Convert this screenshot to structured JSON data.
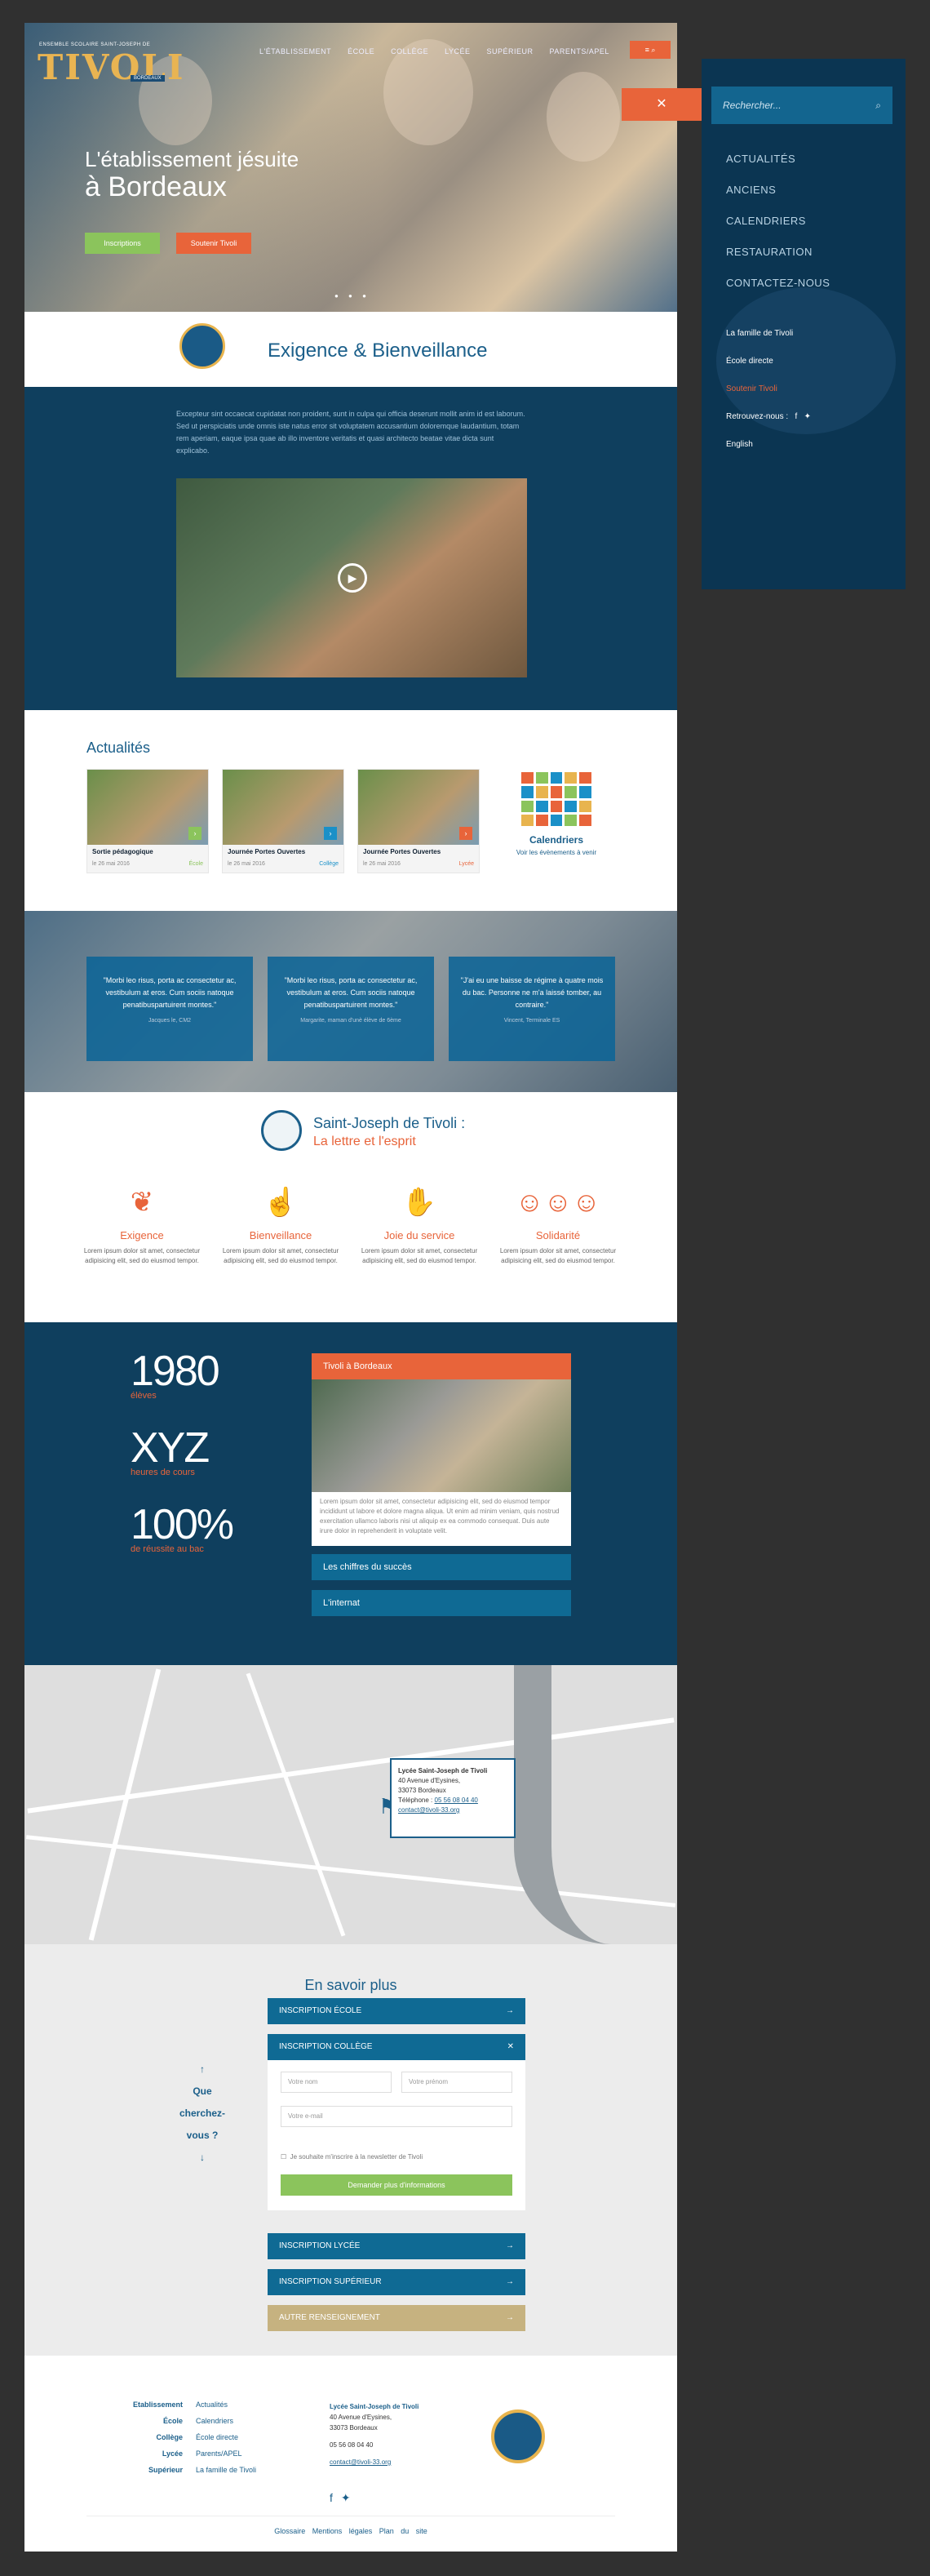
{
  "header": {
    "logo_small": "ENSEMBLE SCOLAIRE SAINT-JOSEPH DE",
    "logo": "TIVOLI",
    "logo_sub": "BORDEAUX",
    "nav": [
      "L'ÉTABLISSEMENT",
      "ÉCOLE",
      "COLLÈGE",
      "LYCÉE",
      "SUPÉRIEUR",
      "PARENTS/APEL"
    ],
    "menu_btn": "≡  ⌕"
  },
  "hero": {
    "title_line1": "L'établissement jésuite",
    "title_line2": "à Bordeaux",
    "btn_primary": "Inscriptions",
    "btn_secondary": "Soutenir Tivoli",
    "dots": "● ● ●"
  },
  "intro": {
    "heading": "Exigence & Bienveillance",
    "text": "Excepteur sint occaecat cupidatat non proident, sunt in culpa qui officia deserunt mollit anim id est laborum. Sed ut perspiciatis unde omnis iste natus error sit voluptatem accusantium doloremque laudantium, totam rem aperiam, eaque ipsa quae ab illo inventore veritatis et quasi architecto beatae vitae dicta sunt explicabo."
  },
  "news": {
    "heading": "Actualités",
    "cards": [
      {
        "title": "Sortie pédagogique",
        "date": "le 26 mai 2016",
        "cat": "École",
        "color": "#8bc45c"
      },
      {
        "title": "Journée Portes Ouvertes",
        "date": "le 26 mai 2016",
        "cat": "Collège",
        "color": "#1a90c8"
      },
      {
        "title": "Journée Portes Ouvertes",
        "date": "le 26 mai 2016",
        "cat": "Lycée",
        "color": "#e8643a"
      }
    ],
    "cal_title": "Calendriers",
    "cal_sub": "Voir les évènements à venir"
  },
  "quotes": [
    {
      "text": "\"Morbi leo risus, porta ac consectetur ac, vestibulum at eros. Cum sociis natoque penatibuspartuirent montes.\"",
      "author": "Jacques le, CM2"
    },
    {
      "text": "\"Morbi leo risus, porta ac consectetur ac, vestibulum at eros. Cum sociis natoque penatibuspartuirent montes.\"",
      "author": "Margarite, maman d'unè élève de 6ème"
    },
    {
      "text": "\"J'ai eu une baisse de régime à quatre mois du bac. Personne ne m'a laissé tomber, au contraire.\"",
      "author": "Vincent, Terminale ES"
    }
  ],
  "values": {
    "title1": "Saint-Joseph de Tivoli :",
    "title2": "La lettre et l'esprit",
    "items": [
      {
        "name": "Exigence",
        "icon": "laurel-icon",
        "text": "Lorem ipsum dolor sit amet, consectetur adipisicing elit, sed do eiusmod tempor."
      },
      {
        "name": "Bienveillance",
        "icon": "hands-icon",
        "text": "Lorem ipsum dolor sit amet, consectetur adipisicing elit, sed do eiusmod tempor."
      },
      {
        "name": "Joie du service",
        "icon": "handshake-icon",
        "text": "Lorem ipsum dolor sit amet, consectetur adipisicing elit, sed do eiusmod tempor."
      },
      {
        "name": "Solidarité",
        "icon": "people-icon",
        "text": "Lorem ipsum dolor sit amet, consectetur adipisicing elit, sed do eiusmod tempor."
      }
    ]
  },
  "stats": {
    "items": [
      {
        "value": "1980",
        "label": "élèves"
      },
      {
        "value": "XYZ",
        "label": "heures de cours"
      },
      {
        "value": "100%",
        "label": "de réussite au bac"
      }
    ],
    "acc1": "Tivoli à Bordeaux",
    "acc_text": "Lorem ipsum dolor sit amet, consectetur adipisicing elit, sed do eiusmod tempor incididunt ut labore et dolore magna aliqua. Ut enim ad minim veniam, quis nostrud exercitation ullamco laboris nisi ut aliquip ex ea commodo consequat. Duis aute irure dolor in reprehenderit in voluptate velit.",
    "acc2": "Les chiffres du succès",
    "acc3": "L'internat"
  },
  "map": {
    "name": "Lycée Saint-Joseph de Tivoli",
    "addr1": "40 Avenue d'Eysines,",
    "addr2": "33073 Bordeaux",
    "phone_label": "Téléphone :",
    "phone": "05 56 08 04 40",
    "email": "contact@tivoli-33.org"
  },
  "more": {
    "heading": "En savoir plus",
    "side": [
      "↑",
      "Que",
      "cherchez-",
      "vous ?",
      "↓"
    ],
    "ac1": "INSCRIPTION ÉCOLE",
    "ac2": "INSCRIPTION COLLÈGE",
    "ph_name": "Votre nom",
    "ph_first": "Votre prénom",
    "ph_email": "Votre e-mail",
    "checkbox": "Je souhaite m'inscrire à la newsletter de Tivoli",
    "submit": "Demander plus d'informations",
    "ac3": "INSCRIPTION LYCÉE",
    "ac4": "INSCRIPTION SUPÉRIEUR",
    "ac5": "AUTRE RENSEIGNEMENT",
    "arrow": "→",
    "close": "✕"
  },
  "footer": {
    "left": [
      "Etablissement",
      "École",
      "Collège",
      "Lycée",
      "Supérieur"
    ],
    "right": [
      "Actualités",
      "Calendriers",
      "École directe",
      "Parents/APEL",
      "La famille de Tivoli"
    ],
    "name": "Lycée Saint-Joseph de Tivoli",
    "addr1": "40 Avenue d'Eysines,",
    "addr2": "33073 Bordeaux",
    "phone": "05 56 08 04 40",
    "email": "contact@tivoli-33.org",
    "links": "Glossaire Mentions légales Plan du site"
  },
  "drawer": {
    "close": "✕",
    "search": "Rechercher...",
    "menu": [
      "ACTUALITÉS",
      "ANCIENS",
      "CALENDRIERS",
      "RESTAURATION",
      "CONTACTEZ-NOUS"
    ],
    "links": [
      "La famille de Tivoli",
      "École directe",
      "Soutenir Tivoli",
      "Retrouvez-nous :",
      "English"
    ]
  },
  "colors": {
    "navy": "#0f3f5e",
    "orange": "#e8643a",
    "green": "#8bc45c",
    "blue": "#1b5f8a",
    "gold": "#c6b280"
  }
}
